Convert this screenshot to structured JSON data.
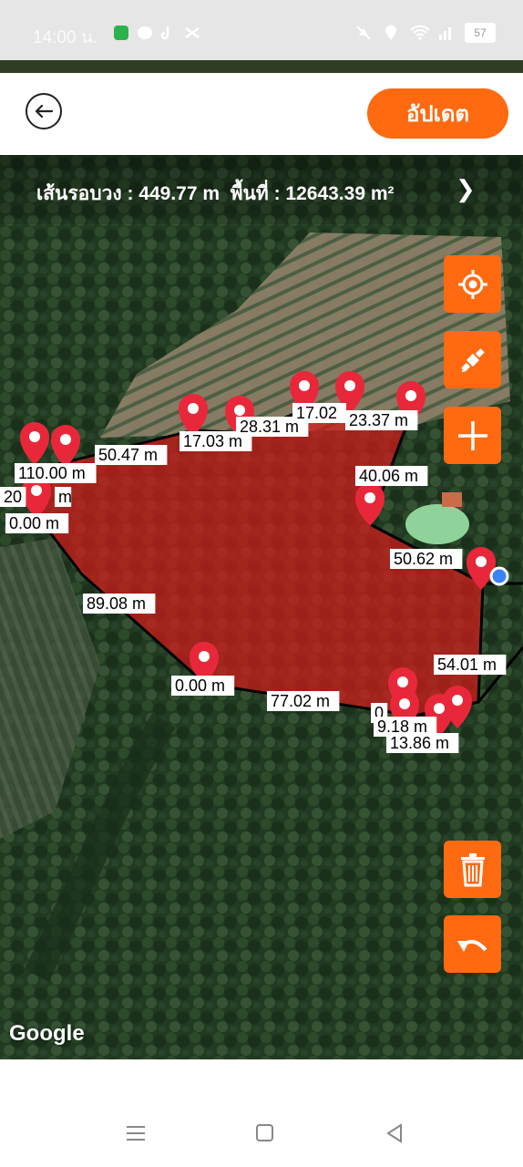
{
  "status_bar": {
    "time": "14:00 น.",
    "battery": "57"
  },
  "app_bar": {
    "update_label": "อัปเดต"
  },
  "measurement": {
    "perimeter_label": "เส้นรอบวง : 449.77 m",
    "area_label": "พื้นที่ : 12643.39 m²"
  },
  "map": {
    "attribution": "Google",
    "polygon_color": "#d21a1a",
    "distance_labels": [
      "50.47 m",
      "110.00 m",
      "20",
      "m",
      "0.00 m",
      "17.03 m",
      "28.31 m",
      "17.02",
      "23.37 m",
      "40.06 m",
      "50.62 m",
      "89.08 m",
      "54.01 m",
      "0.00 m",
      "77.02 m",
      "0",
      "9.18 m",
      "13.86 m"
    ]
  },
  "controls": {
    "locate_icon": "crosshair-icon",
    "satellite_icon": "satellite-icon",
    "add_icon": "plus-icon",
    "delete_icon": "trash-icon",
    "undo_icon": "undo-icon"
  },
  "colors": {
    "accent": "#ff6a10",
    "marker": "#e8283a"
  }
}
